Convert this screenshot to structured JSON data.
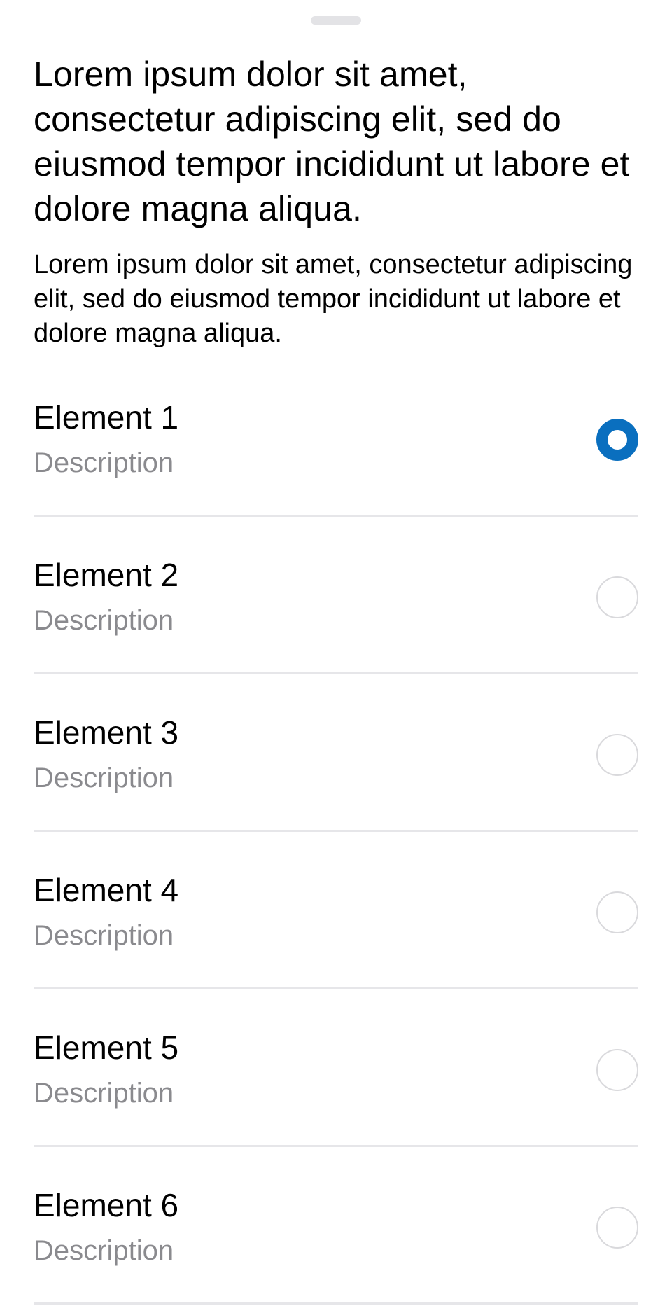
{
  "sheet": {
    "title": "Lorem ipsum dolor sit amet, consectetur adipiscing elit, sed do eiusmod tempor incididunt ut labore et dolore magna aliqua.",
    "subtitle": "Lorem ipsum dolor sit amet, consectetur adipiscing elit, sed do eiusmod tempor incididunt ut labore et dolore magna aliqua."
  },
  "list": {
    "items": [
      {
        "title": "Element 1",
        "description": "Description",
        "selected": true
      },
      {
        "title": "Element 2",
        "description": "Description",
        "selected": false
      },
      {
        "title": "Element 3",
        "description": "Description",
        "selected": false
      },
      {
        "title": "Element 4",
        "description": "Description",
        "selected": false
      },
      {
        "title": "Element 5",
        "description": "Description",
        "selected": false
      },
      {
        "title": "Element 6",
        "description": "Description",
        "selected": false
      }
    ]
  },
  "colors": {
    "accent": "#0a6fbf",
    "secondary_text": "#8a8a8e",
    "divider": "#e6e6e9"
  }
}
